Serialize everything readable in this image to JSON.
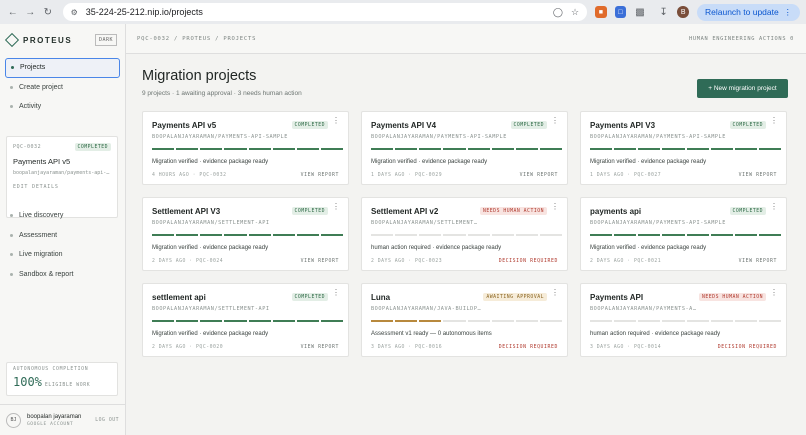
{
  "browser": {
    "url": "35-224-25-212.nip.io/projects",
    "relaunch_label": "Relaunch to update",
    "profile_initial": "B"
  },
  "sidebar": {
    "brand": "PROTEUS",
    "theme_toggle": "DARK",
    "nav": [
      {
        "label": "Projects",
        "active": true
      },
      {
        "label": "Create project",
        "active": false
      },
      {
        "label": "Activity",
        "active": false
      }
    ],
    "current_project": {
      "id": "PQC-0032",
      "status": "COMPLETED",
      "name": "Payments API v5",
      "path": "boopalanjayaraman/payments-api-…",
      "edit_label": "EDIT DETAILS"
    },
    "nav2": [
      {
        "label": "Live discovery"
      },
      {
        "label": "Assessment"
      },
      {
        "label": "Live migration"
      },
      {
        "label": "Sandbox & report"
      }
    ],
    "autonomous": {
      "label": "AUTONOMOUS COMPLETION",
      "value": "100%",
      "sub": "ELIGIBLE WORK"
    },
    "user": {
      "initials": "BJ",
      "name": "boopalan jayaraman",
      "account": "GOOGLE ACCOUNT",
      "logout": "LOG OUT"
    }
  },
  "header": {
    "breadcrumb": "PQC-0032 / PROTEUS / PROJECTS",
    "actions_label": "HUMAN ENGINEERING ACTIONS 0"
  },
  "main": {
    "title": "Migration projects",
    "subtitle": "9 projects · 1 awaiting approval · 3 needs human action",
    "new_button": "+ New migration project"
  },
  "projects": [
    {
      "name": "Payments API v5",
      "badge": "COMPLETED",
      "badge_type": "completed",
      "path": "BOOPALANJAYARAMAN/PAYMENTS-API-SAMPLE",
      "progress": 8,
      "status": "Migration verified · evidence package ready",
      "meta": "4 HOURS AGO · PQC-0032",
      "action": "VIEW REPORT",
      "action_type": "normal"
    },
    {
      "name": "Payments API V4",
      "badge": "COMPLETED",
      "badge_type": "completed",
      "path": "BOOPALANJAYARAMAN/PAYMENTS-API-SAMPLE",
      "progress": 8,
      "status": "Migration verified · evidence package ready",
      "meta": "1 DAYS AGO · PQC-0029",
      "action": "VIEW REPORT",
      "action_type": "normal"
    },
    {
      "name": "Payments API V3",
      "badge": "COMPLETED",
      "badge_type": "completed",
      "path": "BOOPALANJAYARAMAN/PAYMENTS-API-SAMPLE",
      "progress": 8,
      "status": "Migration verified · evidence package ready",
      "meta": "1 DAYS AGO · PQC-0027",
      "action": "VIEW REPORT",
      "action_type": "normal"
    },
    {
      "name": "Settlement API V3",
      "badge": "COMPLETED",
      "badge_type": "completed",
      "path": "BOOPALANJAYARAMAN/SETTLEMENT-API",
      "progress": 8,
      "status": "Migration verified · evidence package ready",
      "meta": "2 DAYS AGO · PQC-0024",
      "action": "VIEW REPORT",
      "action_type": "normal"
    },
    {
      "name": "Settlement API v2",
      "badge": "NEEDS HUMAN ACTION",
      "badge_type": "needs",
      "path": "BOOPALANJAYARAMAN/SETTLEMENT…",
      "progress": 0,
      "status": "human action required · evidence package ready",
      "meta": "2 DAYS AGO · PQC-0023",
      "action": "DECISION REQUIRED",
      "action_type": "red"
    },
    {
      "name": "payments api",
      "badge": "COMPLETED",
      "badge_type": "completed",
      "path": "BOOPALANJAYARAMAN/PAYMENTS-API-SAMPLE",
      "progress": 8,
      "status": "Migration verified · evidence package ready",
      "meta": "2 DAYS AGO · PQC-0021",
      "action": "VIEW REPORT",
      "action_type": "normal"
    },
    {
      "name": "settlement api",
      "badge": "COMPLETED",
      "badge_type": "completed",
      "path": "BOOPALANJAYARAMAN/SETTLEMENT-API",
      "progress": 8,
      "status": "Migration verified · evidence package ready",
      "meta": "2 DAYS AGO · PQC-0020",
      "action": "VIEW REPORT",
      "action_type": "normal"
    },
    {
      "name": "Luna",
      "badge": "AWAITING APPROVAL",
      "badge_type": "await",
      "path": "BOOPALANJAYARAMAN/JAVA-BUILDP…",
      "progress": 3,
      "status": "Assessment v1 ready — 0 autonomous items",
      "meta": "3 DAYS AGO · PQC-0016",
      "action": "DECISION REQUIRED",
      "action_type": "red"
    },
    {
      "name": "Payments API",
      "badge": "NEEDS HUMAN ACTION",
      "badge_type": "needs",
      "path": "BOOPALANJAYARAMAN/PAYMENTS-A…",
      "progress": 0,
      "status": "human action required · evidence package ready",
      "meta": "3 DAYS AGO · PQC-0014",
      "action": "DECISION REQUIRED",
      "action_type": "red"
    }
  ],
  "colors": {
    "accent": "#2f6b57",
    "progress_done": "#3f7d55",
    "progress_await": "#b8893d",
    "progress_empty": "#e4e4e2",
    "danger": "#b03a2e"
  }
}
